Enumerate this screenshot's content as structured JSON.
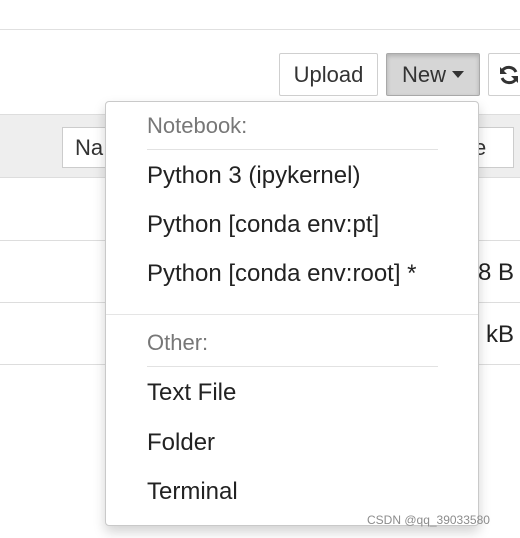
{
  "toolbar": {
    "upload_label": "Upload",
    "new_label": "New"
  },
  "list_header": {
    "name_partial": "Na",
    "size_partial": "ze"
  },
  "rows": [
    {
      "size_partial": "8 B"
    },
    {
      "size_partial": "kB"
    }
  ],
  "new_menu": {
    "notebook_header": "Notebook:",
    "notebook_items": [
      "Python 3 (ipykernel)",
      "Python [conda env:pt]",
      "Python [conda env:root] *"
    ],
    "other_header": "Other:",
    "other_items": [
      "Text File",
      "Folder",
      "Terminal"
    ]
  },
  "watermark": "CSDN @qq_39033580",
  "icons": {
    "refresh": "refresh-icon",
    "new_caret": "caret-down-icon"
  }
}
